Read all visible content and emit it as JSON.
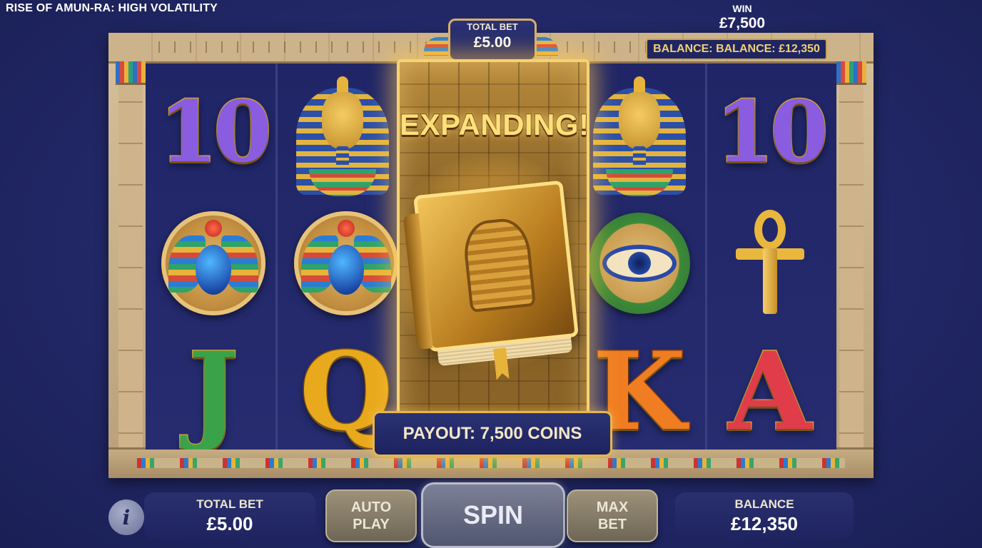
{
  "game": {
    "title": "RISE OF AMUN-RA: HIGH VOLATILITY"
  },
  "header": {
    "total_bet_label": "TOTAL BET",
    "total_bet_value": "£5.00",
    "win_label": "WIN",
    "win_value": "£7,500",
    "balance_text": "BALANCE: BALANCE: £12,350"
  },
  "reels": {
    "columns": [
      [
        "10",
        "scarab",
        "J"
      ],
      [
        "pharaoh",
        "scarab",
        "Q"
      ],
      [
        "book-expanded"
      ],
      [
        "pharaoh",
        "eye-of-horus",
        "K"
      ],
      [
        "10",
        "ankh",
        "A"
      ]
    ],
    "expanding_label": "EXPANDING!",
    "payout_text": "PAYOUT: 7,500 COINS"
  },
  "controls": {
    "info_icon": "i",
    "total_bet_label": "TOTAL BET",
    "total_bet_value": "£5.00",
    "auto_play_line1": "AUTO",
    "auto_play_line2": "PLAY",
    "spin_label": "SPIN",
    "max_bet_line1": "MAX",
    "max_bet_line2": "BET",
    "balance_label": "BALANCE",
    "balance_value": "£12,350"
  },
  "icons": {
    "info": "info-icon",
    "scarab": "scarab-icon",
    "pharaoh": "pharaoh-mask-icon",
    "eye": "eye-of-horus-icon",
    "ankh": "ankh-icon",
    "book": "book-of-dead-icon"
  },
  "colors": {
    "background": "#222867",
    "gold": "#e6b650",
    "ten_purple": "#8a5ce0",
    "j_green": "#3aa34a",
    "q_gold": "#e8a91c",
    "k_orange": "#f07d22",
    "a_red": "#e03c4a"
  }
}
